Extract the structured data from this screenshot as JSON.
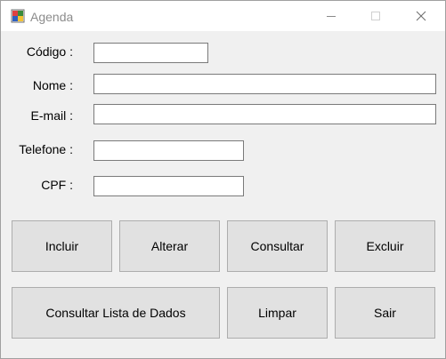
{
  "window": {
    "title": "Agenda",
    "app_icon": "windows-forms-app-icon",
    "controls": {
      "minimize": "minimize-icon",
      "maximize": "maximize-icon",
      "close": "close-icon"
    }
  },
  "form": {
    "codigo": {
      "label": "Código :",
      "value": ""
    },
    "nome": {
      "label": "Nome :",
      "value": ""
    },
    "email": {
      "label": "E-mail :",
      "value": ""
    },
    "telefone": {
      "label": "Telefone :",
      "value": ""
    },
    "cpf": {
      "label": "CPF :",
      "value": ""
    }
  },
  "buttons": {
    "incluir": "Incluir",
    "alterar": "Alterar",
    "consultar": "Consultar",
    "excluir": "Excluir",
    "consultar_lista": "Consultar Lista de Dados",
    "limpar": "Limpar",
    "sair": "Sair"
  },
  "colors": {
    "window_bg": "#f0f0f0",
    "button_bg": "#e1e1e1",
    "button_border": "#adadad",
    "title_text": "#8c8c8c"
  }
}
